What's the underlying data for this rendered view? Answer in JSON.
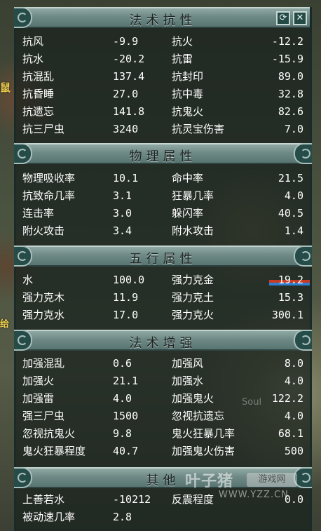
{
  "window": {
    "refresh_icon": "refresh-icon",
    "close_icon": "close-icon"
  },
  "left_fragments": [
    "鼠",
    "给"
  ],
  "sections": {
    "resist": {
      "title": "法术抗性",
      "rows": [
        [
          "抗风",
          "-9.9",
          "抗火",
          "-12.2"
        ],
        [
          "抗水",
          "-20.2",
          "抗雷",
          "-15.9"
        ],
        [
          "抗混乱",
          "137.4",
          "抗封印",
          "89.0"
        ],
        [
          "抗昏睡",
          "27.0",
          "抗中毒",
          "32.8"
        ],
        [
          "抗遗忘",
          "141.8",
          "抗鬼火",
          "82.6"
        ],
        [
          "抗三尸虫",
          "3240",
          "抗灵宝伤害",
          "7.0"
        ]
      ]
    },
    "physical": {
      "title": "物理属性",
      "rows": [
        [
          "物理吸收率",
          "10.1",
          "命中率",
          "21.5"
        ],
        [
          "抗致命几率",
          "3.1",
          "狂暴几率",
          "4.0"
        ],
        [
          "连击率",
          "3.0",
          "躲闪率",
          "40.5"
        ],
        [
          "附火攻击",
          "3.4",
          "附水攻击",
          "1.4"
        ]
      ]
    },
    "elements": {
      "title": "五行属性",
      "rows": [
        [
          "水",
          "100.0",
          "强力克金",
          "19.2"
        ],
        [
          "强力克木",
          "11.9",
          "强力克土",
          "15.3"
        ],
        [
          "强力克水",
          "17.0",
          "强力克火",
          "300.1"
        ]
      ]
    },
    "enhance": {
      "title": "法术增强",
      "rows": [
        [
          "加强混乱",
          "0.6",
          "加强风",
          "8.0"
        ],
        [
          "加强火",
          "21.1",
          "加强水",
          "4.0"
        ],
        [
          "加强雷",
          "4.0",
          "加强鬼火",
          "122.2"
        ],
        [
          "强三尸虫",
          "1500",
          "忽视抗遗忘",
          "4.0"
        ],
        [
          "忽视抗鬼火",
          "9.8",
          "鬼火狂暴几率",
          "68.1"
        ],
        [
          "鬼火狂暴程度",
          "40.7",
          "加强鬼火伤害",
          "500"
        ]
      ]
    },
    "other": {
      "title": "其他",
      "rows": [
        [
          "上善若水",
          "-10212",
          "反震程度",
          "0.0"
        ],
        [
          "被动速几率",
          "2.8",
          "",
          ""
        ]
      ]
    }
  },
  "watermark": {
    "logo": "叶子猪",
    "badge": "游戏网",
    "url": "WWW.YZZ.CN",
    "soul": "Soul"
  },
  "colors": {
    "header": "#6f8a86",
    "panel": "#18221e",
    "text": "#ffffff",
    "bar_red": "#c83a24",
    "bar_blue": "#2f7fd0"
  }
}
